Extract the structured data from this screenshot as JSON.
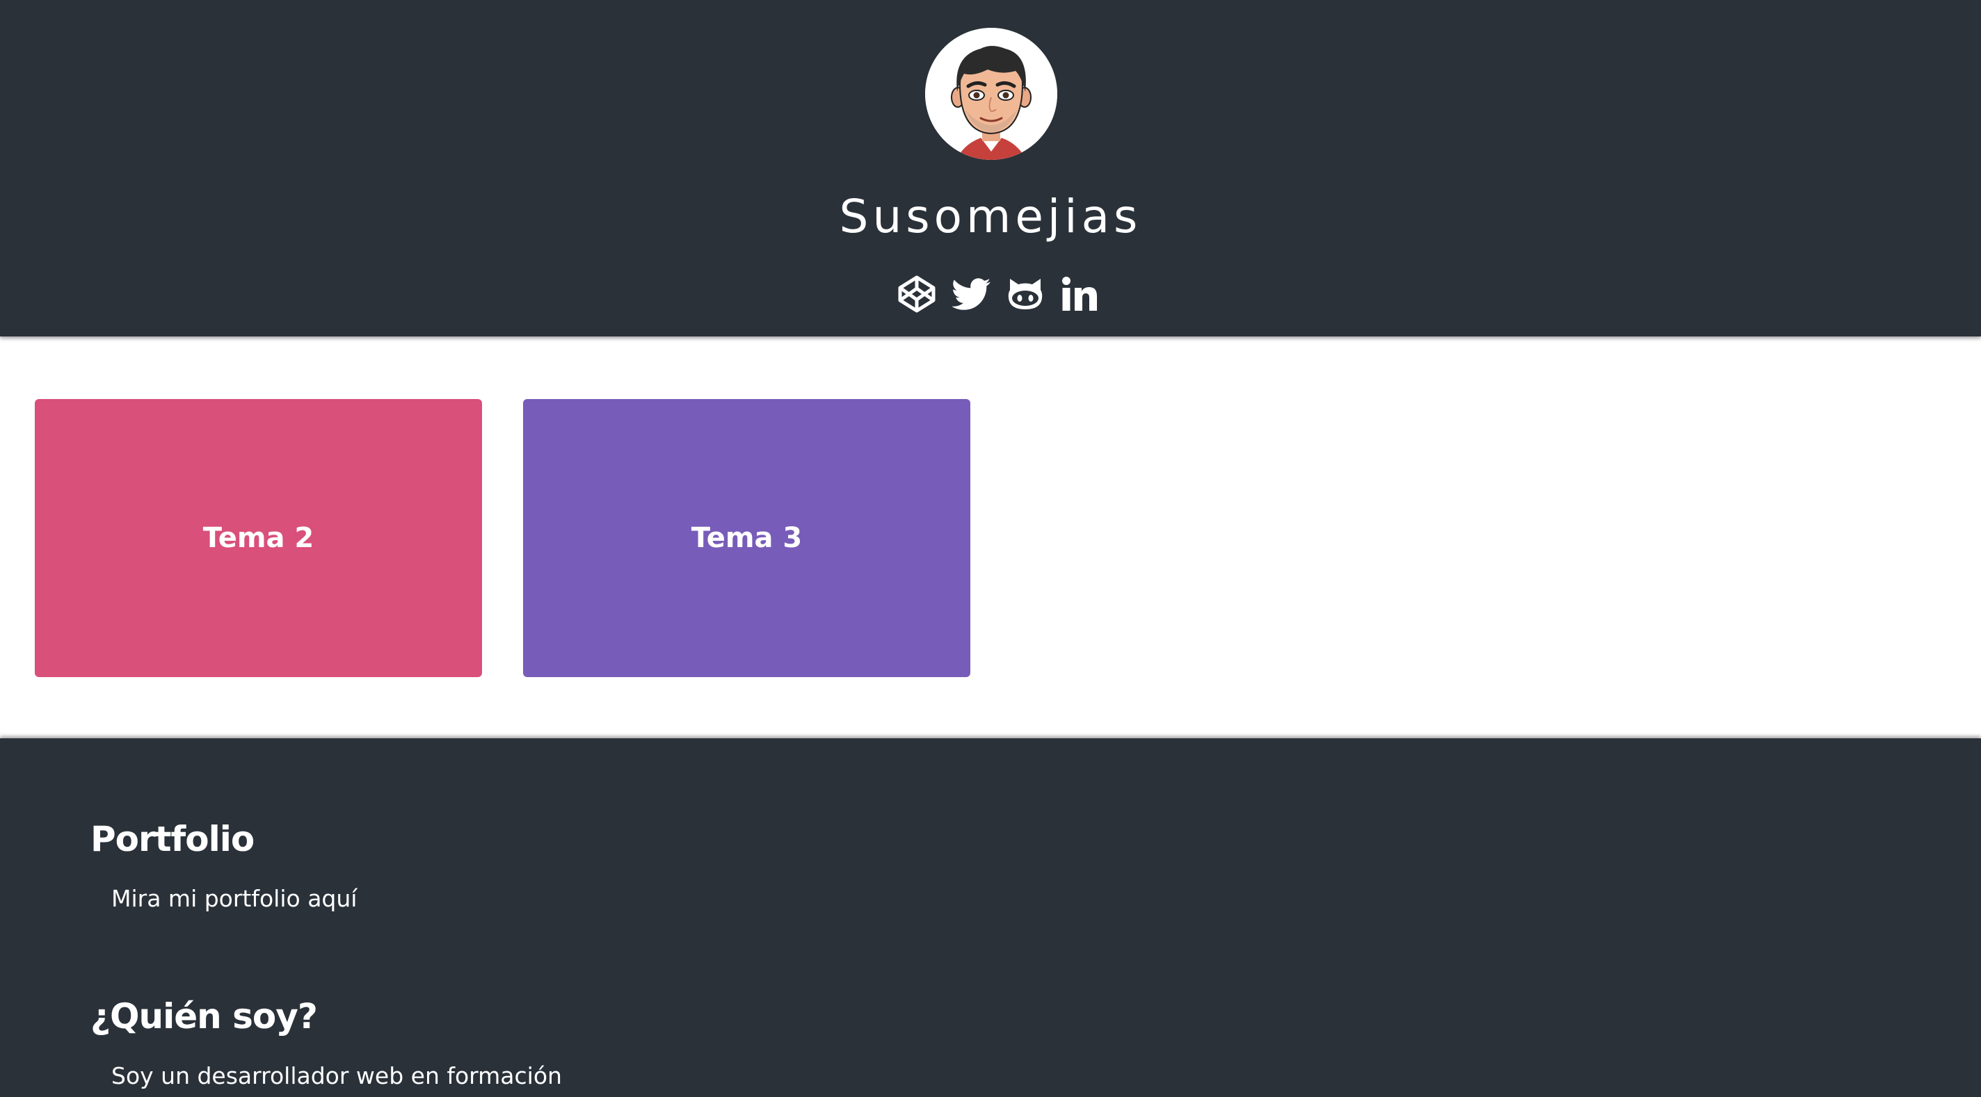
{
  "header": {
    "title": "Susomejias",
    "avatar_icon": "avatar-image",
    "social": [
      {
        "icon": "codepen-icon"
      },
      {
        "icon": "twitter-icon"
      },
      {
        "icon": "github-icon"
      },
      {
        "icon": "linkedin-icon"
      }
    ]
  },
  "cards": [
    {
      "label": "Tema 2",
      "color": "#d9507a"
    },
    {
      "label": "Tema 3",
      "color": "#785cb9"
    }
  ],
  "footer": {
    "portfolio": {
      "heading": "Portfolio",
      "text": "Mira mi portfolio aquí"
    },
    "about": {
      "heading": "¿Quién soy?",
      "text": "Soy un desarrollador web en formación"
    }
  },
  "colors": {
    "dark_bg": "#2a3139",
    "text_light": "#ffffff"
  }
}
